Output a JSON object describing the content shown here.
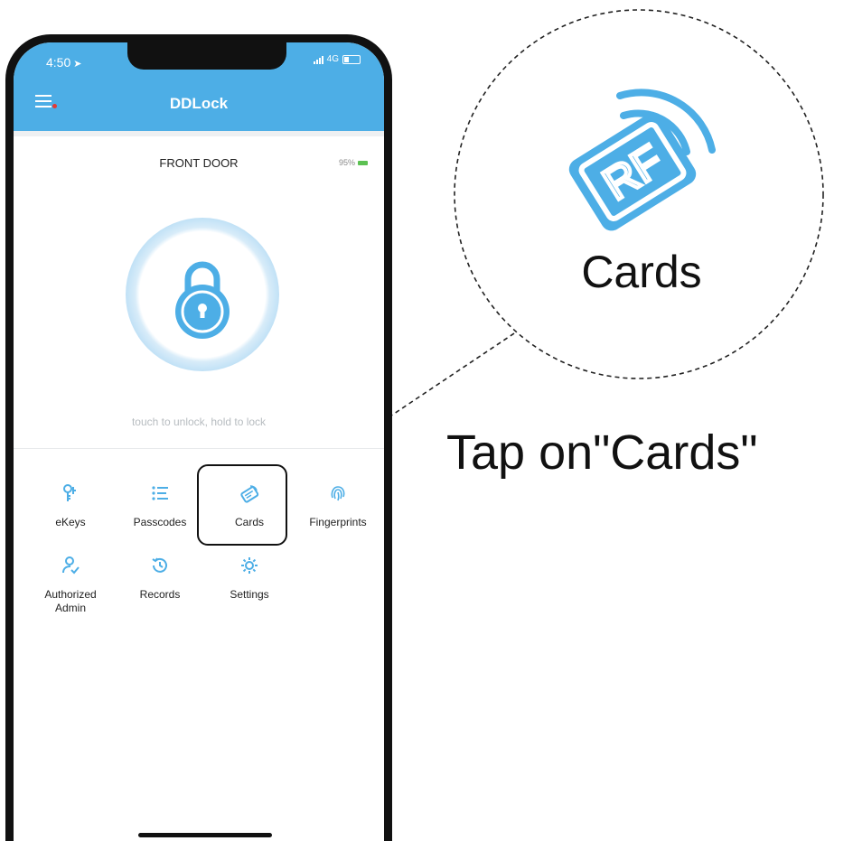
{
  "status_bar": {
    "time": "4:50",
    "network": "4G"
  },
  "header": {
    "title": "DDLock"
  },
  "lock": {
    "name": "FRONT DOOR",
    "battery": "95%",
    "hint": "touch to unlock, hold to lock"
  },
  "menu": {
    "ekeys": "eKeys",
    "passcodes": "Passcodes",
    "cards": "Cards",
    "fingerprints": "Fingerprints",
    "authorized_admin_line1": "Authorized",
    "authorized_admin_line2": "Admin",
    "records": "Records",
    "settings": "Settings"
  },
  "callout": {
    "icon_text": "RF",
    "zoom_label": "Cards",
    "instruction": "Tap on\"Cards\""
  },
  "colors": {
    "accent": "#4daee6",
    "battery_green": "#5cc152"
  },
  "icons": [
    "menu-icon",
    "padlock-icon",
    "ekey-icon",
    "passcode-list-icon",
    "rf-card-icon",
    "fingerprint-icon",
    "admin-icon",
    "history-icon",
    "gear-icon"
  ]
}
